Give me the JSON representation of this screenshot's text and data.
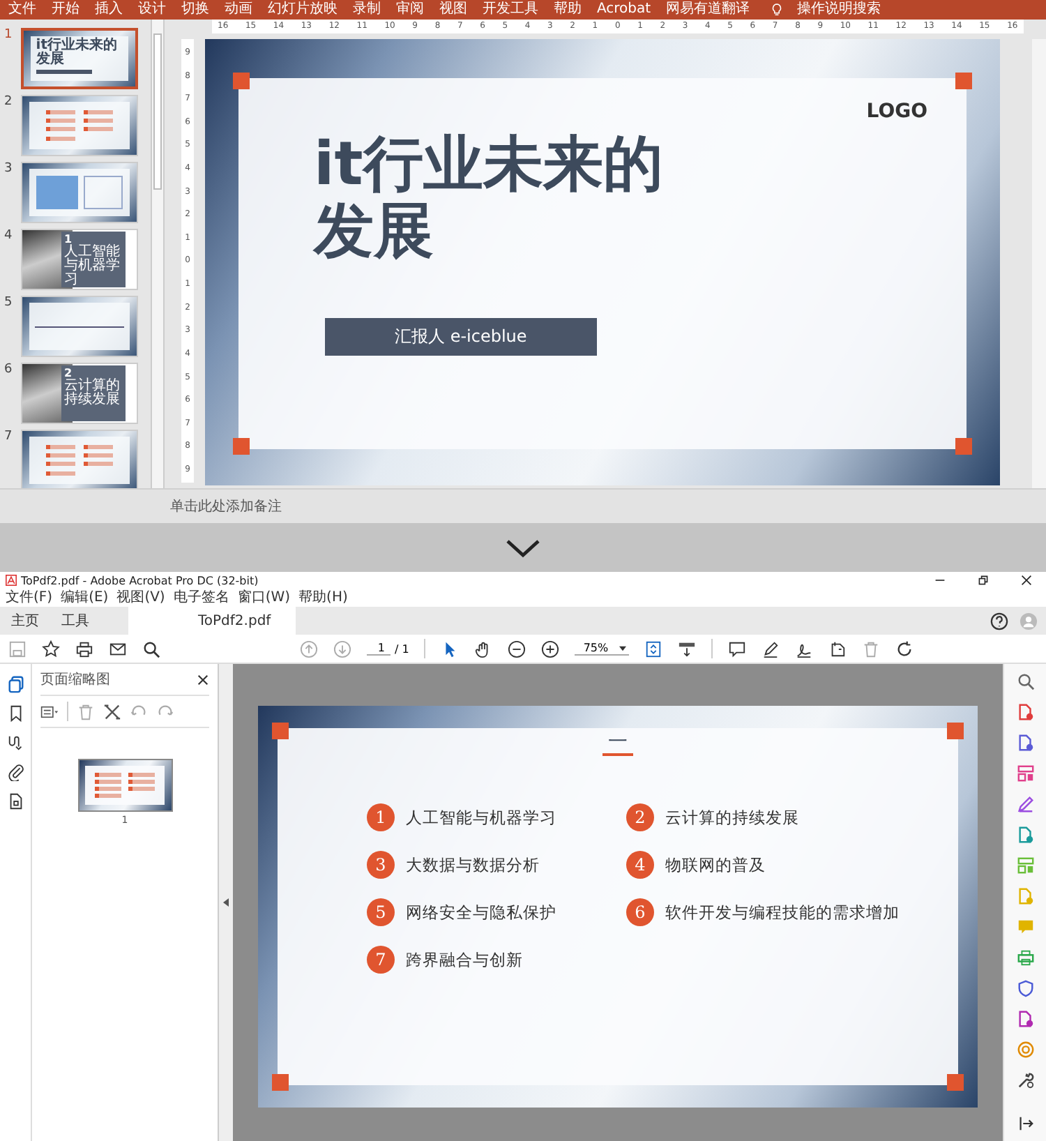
{
  "powerpoint": {
    "menu": [
      "文件",
      "开始",
      "插入",
      "设计",
      "切换",
      "动画",
      "幻灯片放映",
      "录制",
      "审阅",
      "视图",
      "开发工具",
      "帮助",
      "Acrobat",
      "网易有道翻译"
    ],
    "tell_me": "操作说明搜索",
    "ruler_h": [
      "16",
      "15",
      "14",
      "13",
      "12",
      "11",
      "10",
      "9",
      "8",
      "7",
      "6",
      "5",
      "4",
      "3",
      "2",
      "1",
      "0",
      "1",
      "2",
      "3",
      "4",
      "5",
      "6",
      "7",
      "8",
      "9",
      "10",
      "11",
      "12",
      "13",
      "14",
      "15",
      "16"
    ],
    "ruler_v": [
      "9",
      "8",
      "7",
      "6",
      "5",
      "4",
      "3",
      "2",
      "1",
      "0",
      "1",
      "2",
      "3",
      "4",
      "5",
      "6",
      "7",
      "8",
      "9"
    ],
    "thumbnails": [
      {
        "number": "1",
        "selected": true,
        "kind": "title",
        "title_lines": [
          "it行业未来的",
          "发展"
        ]
      },
      {
        "number": "2",
        "selected": false,
        "kind": "list"
      },
      {
        "number": "3",
        "selected": false,
        "kind": "diagram"
      },
      {
        "number": "4",
        "selected": false,
        "kind": "section",
        "index": "1",
        "label": "人工智能与机器学习"
      },
      {
        "number": "5",
        "selected": false,
        "kind": "timeline"
      },
      {
        "number": "6",
        "selected": false,
        "kind": "section",
        "index": "2",
        "label": "云计算的持续发展"
      },
      {
        "number": "7",
        "selected": false,
        "kind": "list"
      }
    ],
    "slide": {
      "logo": "LOGO",
      "title_lines": [
        "it行业未来的",
        "发展"
      ],
      "presenter": "汇报人 e-iceblue"
    },
    "notes_placeholder": "单击此处添加备注"
  },
  "acrobat": {
    "window_title": "ToPdf2.pdf - Adobe Acrobat Pro DC (32-bit)",
    "menu": [
      "文件(F)",
      "编辑(E)",
      "视图(V)",
      "电子签名",
      "窗口(W)",
      "帮助(H)"
    ],
    "tabs": [
      {
        "label": "主页",
        "selected": false
      },
      {
        "label": "工具",
        "selected": false
      },
      {
        "label": "ToPdf2.pdf",
        "selected": true
      }
    ],
    "page_number": "1",
    "page_total": "/ 1",
    "zoom": "75%",
    "panel_title": "页面缩略图",
    "thumbnail_page": "1",
    "page": {
      "heading": "一",
      "items": [
        {
          "number": "1",
          "label": "人工智能与机器学习"
        },
        {
          "number": "2",
          "label": "云计算的持续发展"
        },
        {
          "number": "3",
          "label": "大数据与数据分析"
        },
        {
          "number": "4",
          "label": "物联网的普及"
        },
        {
          "number": "5",
          "label": "网络安全与隐私保护"
        },
        {
          "number": "6",
          "label": "软件开发与编程技能的需求增加"
        },
        {
          "number": "7",
          "label": "跨界融合与创新"
        }
      ]
    }
  }
}
